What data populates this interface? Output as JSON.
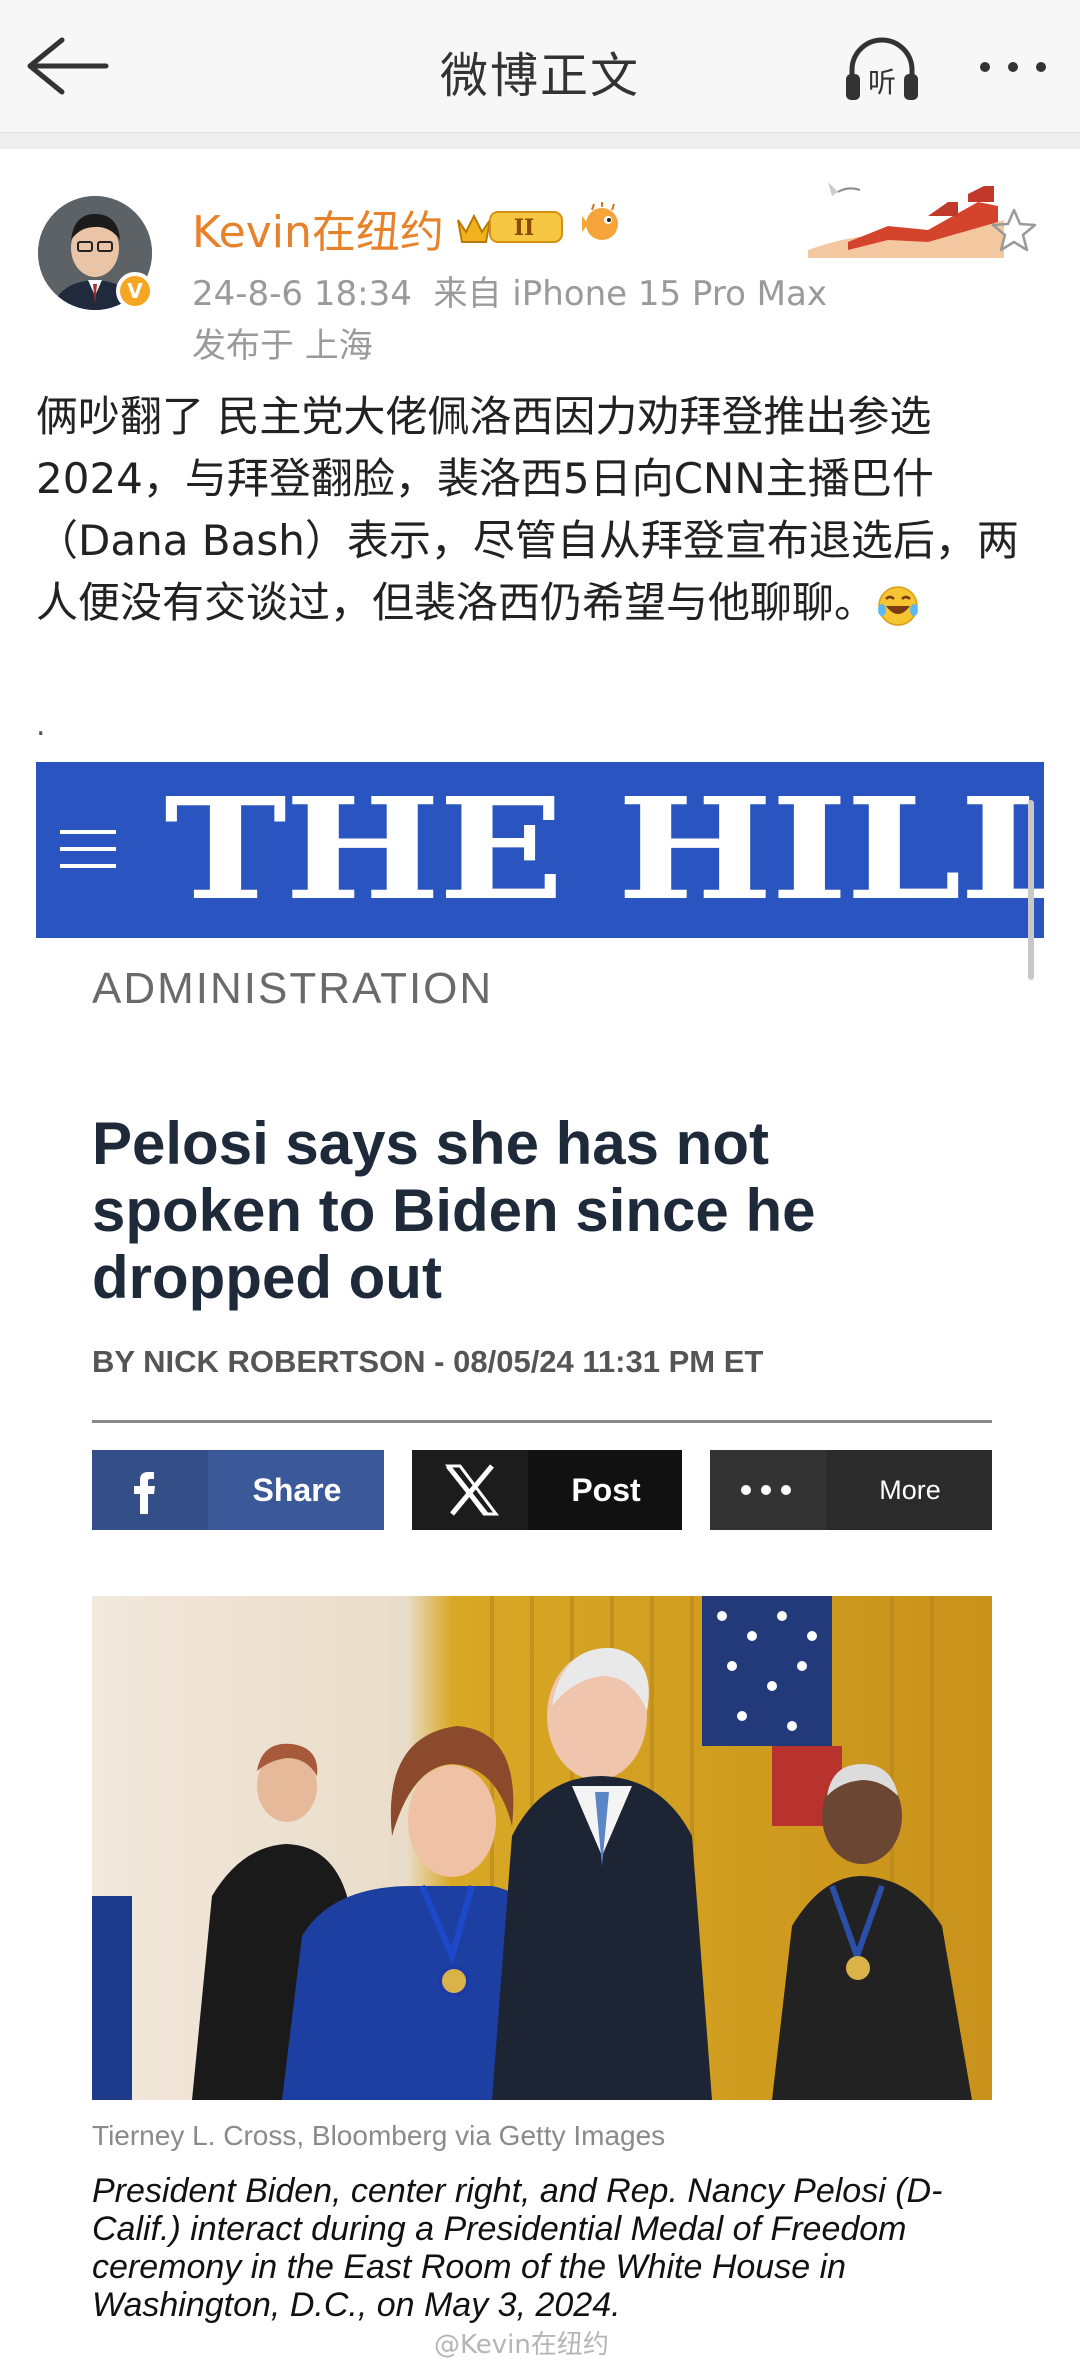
{
  "nav": {
    "title": "微博正文",
    "listen_label": "听"
  },
  "post": {
    "username": "Kevin在纽约",
    "crown_level": "II",
    "timestamp": "24-8-6 18:34",
    "source": "来自 iPhone 15 Pro Max",
    "location": "发布于 上海",
    "text": "俩吵翻了 民主党大佬佩洛西因力劝拜登推出参选2024，与拜登翻脸，裴洛西5日向CNN主播巴什（Dana Bash）表示，尽管自从拜登宣布退选后，两人便没有交谈过，但裴洛西仍希望与他聊聊。",
    "separator": "."
  },
  "article": {
    "brand": "THE HILL",
    "section": "ADMINISTRATION",
    "headline": "Pelosi says she has not spoken to Biden since he dropped out",
    "byline": "BY NICK ROBERTSON - 08/05/24 11:31 PM ET",
    "share_buttons": {
      "facebook": "Share",
      "x": "Post",
      "more": "More"
    },
    "photo_credit": "Tierney L. Cross, Bloomberg via Getty Images",
    "caption": "President Biden, center right, and Rep. Nancy Pelosi (D-Calif.) interact during a Presidential Medal of Freedom ceremony in the East Room of the White House in Washington, D.C., on May 3, 2024."
  },
  "watermark": "@Kevin在纽约",
  "colors": {
    "username": "#e8822a",
    "hill_blue": "#2a55c0",
    "facebook": "#3b5998"
  }
}
